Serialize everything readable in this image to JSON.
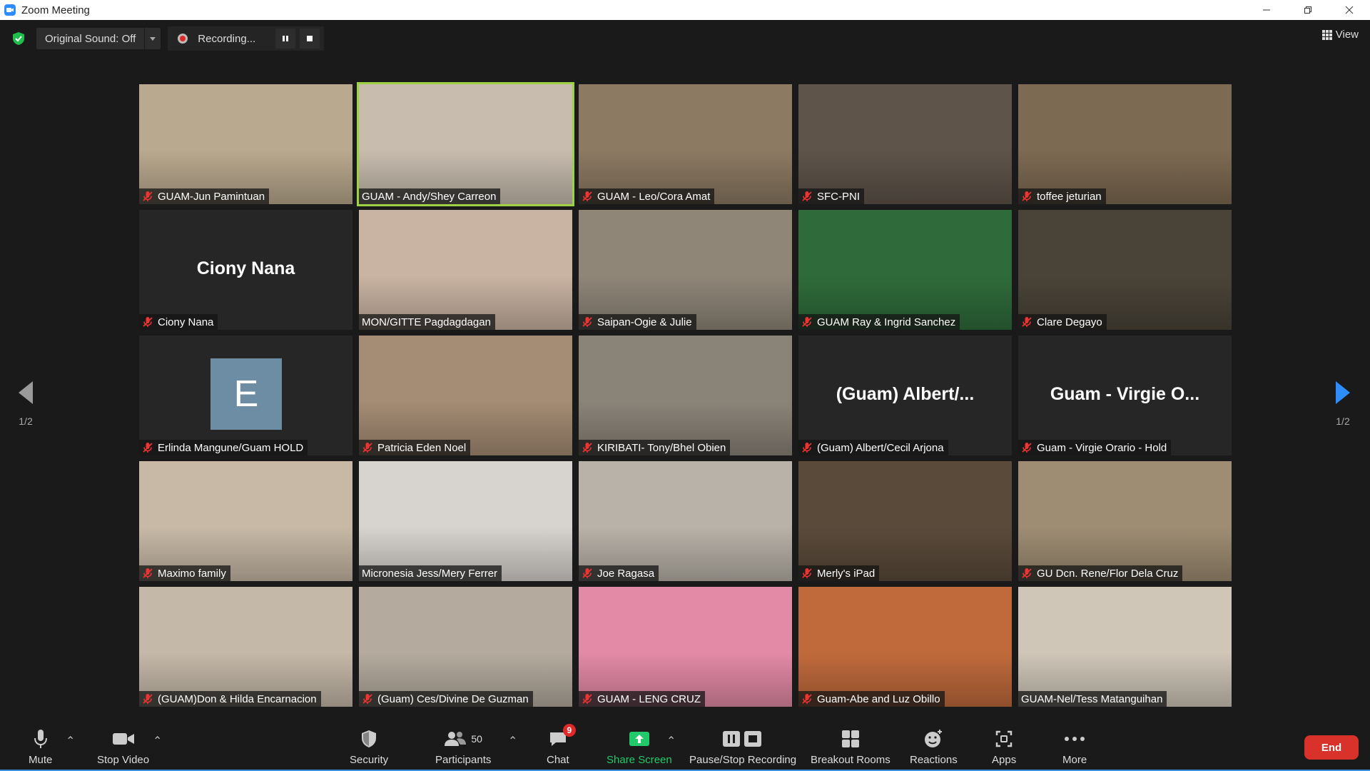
{
  "window": {
    "title": "Zoom Meeting"
  },
  "topbar": {
    "original_sound": "Original Sound: Off",
    "recording": "Recording...",
    "view": "View"
  },
  "gallery": {
    "page_indicator": "1/2",
    "tiles": [
      {
        "name": "GUAM-Jun Pamintuan",
        "mic_muted": true,
        "bg": "#b9a98e"
      },
      {
        "name": "GUAM - Andy/Shey Carreon",
        "mic_muted": false,
        "active": true,
        "bg": "#c7bcae"
      },
      {
        "name": "GUAM - Leo/Cora Amat",
        "mic_muted": true,
        "bg": "#8c7a63"
      },
      {
        "name": "SFC-PNI",
        "mic_muted": true,
        "bg": "#5e544a"
      },
      {
        "name": "toffee jeturian",
        "mic_muted": true,
        "bg": "#7d6a52"
      },
      {
        "name": "Ciony Nana",
        "mic_muted": true,
        "bg": "#262626",
        "display": "Ciony Nana"
      },
      {
        "name": "MON/GITTE Pagdagdagan",
        "mic_muted": false,
        "bg": "#c9b3a2"
      },
      {
        "name": "Saipan-Ogie & Julie",
        "mic_muted": true,
        "bg": "#8f8678"
      },
      {
        "name": "GUAM Ray & Ingrid Sanchez",
        "mic_muted": true,
        "bg": "#2f6b3a"
      },
      {
        "name": "Clare Degayo",
        "mic_muted": true,
        "bg": "#4a4438"
      },
      {
        "name": "Erlinda Mangune/Guam HOLD",
        "mic_muted": true,
        "bg": "#262626",
        "avatar": "E"
      },
      {
        "name": "Patricia Eden Noel",
        "mic_muted": true,
        "bg": "#a58c74"
      },
      {
        "name": "KIRIBATI- Tony/Bhel Obien",
        "mic_muted": true,
        "bg": "#8a8378"
      },
      {
        "name": "(Guam) Albert/Cecil Arjona",
        "mic_muted": true,
        "bg": "#262626",
        "display": "(Guam)  Albert/..."
      },
      {
        "name": "Guam - Virgie Orario - Hold",
        "mic_muted": true,
        "bg": "#262626",
        "display": "Guam  -  Virgie  O..."
      },
      {
        "name": "Maximo family",
        "mic_muted": true,
        "bg": "#c7b9a6"
      },
      {
        "name": "Micronesia Jess/Mery Ferrer",
        "mic_muted": false,
        "bg": "#d7d3cf"
      },
      {
        "name": "Joe Ragasa",
        "mic_muted": true,
        "bg": "#b8b2a8"
      },
      {
        "name": "Merly's iPad",
        "mic_muted": true,
        "bg": "#5a4a3a"
      },
      {
        "name": "GU Dcn. Rene/Flor Dela Cruz",
        "mic_muted": true,
        "bg": "#9e8d73"
      },
      {
        "name": "(GUAM)Don & Hilda Encarnacion",
        "mic_muted": true,
        "bg": "#c4b8a8"
      },
      {
        "name": "(Guam) Ces/Divine De Guzman",
        "mic_muted": true,
        "bg": "#b4ab9e"
      },
      {
        "name": "GUAM - LENG CRUZ",
        "mic_muted": true,
        "bg": "#e38aa6"
      },
      {
        "name": "Guam-Abe and Luz Obillo",
        "mic_muted": true,
        "bg": "#c06a3c"
      },
      {
        "name": "GUAM-Nel/Tess Matanguihan",
        "mic_muted": false,
        "bg": "#cfc6b8"
      }
    ]
  },
  "toolbar": {
    "mute": "Mute",
    "stop_video": "Stop Video",
    "security": "Security",
    "participants": "Participants",
    "participants_count": "50",
    "chat": "Chat",
    "chat_badge": "9",
    "share_screen": "Share Screen",
    "pause_stop_recording": "Pause/Stop Recording",
    "breakout_rooms": "Breakout Rooms",
    "reactions": "Reactions",
    "apps": "Apps",
    "more": "More",
    "end": "End"
  },
  "colors": {
    "accent": "#2d8cff",
    "active_speaker": "#9cd243",
    "share_green": "#22c96b",
    "end_red": "#d9322b"
  }
}
